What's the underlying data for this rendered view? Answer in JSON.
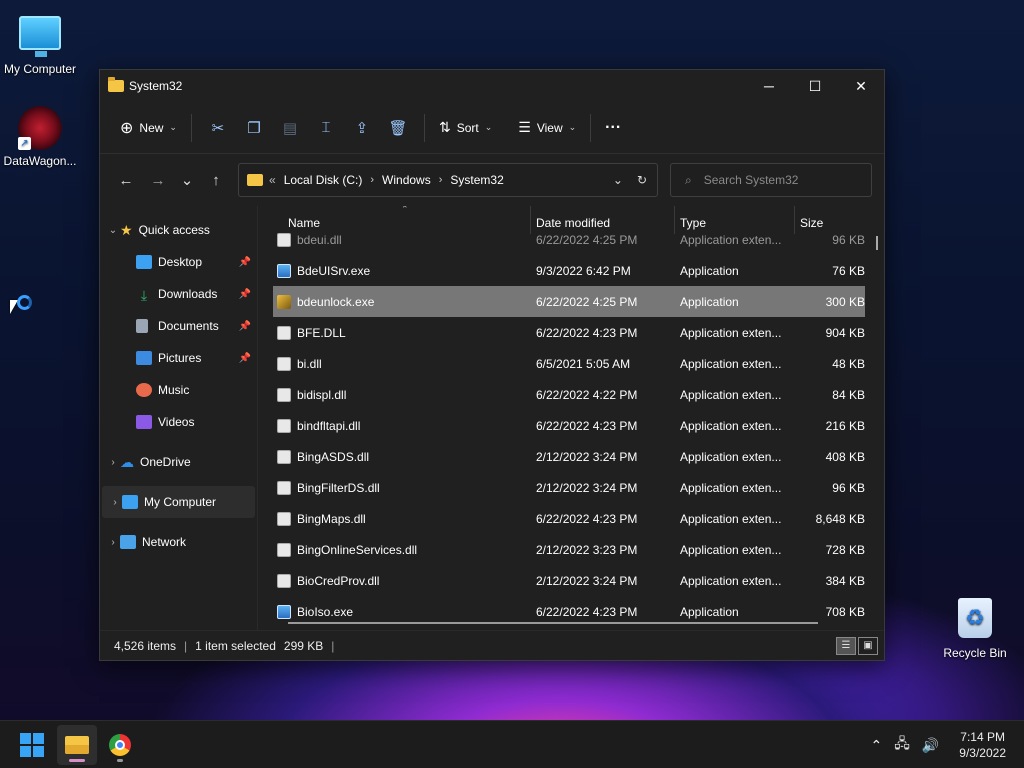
{
  "desktop": {
    "icons": [
      {
        "label": "My Computer"
      },
      {
        "label": "DataWagon..."
      },
      {
        "label": "Recycle Bin"
      }
    ]
  },
  "window": {
    "title": "System32",
    "controls": {
      "minimize": "─",
      "maximize": "☐",
      "close": "✕"
    }
  },
  "toolbar": {
    "new_label": "New",
    "sort_label": "Sort",
    "view_label": "View",
    "more_label": "···",
    "icons": [
      "cut-icon",
      "copy-icon",
      "paste-icon",
      "rename-icon",
      "share-icon",
      "delete-icon"
    ]
  },
  "navigation": {
    "back": "←",
    "forward": "→",
    "recent": "⌄",
    "up": "↑",
    "breadcrumb_prefix": "«",
    "breadcrumb": [
      "Local Disk (C:)",
      "Windows",
      "System32"
    ],
    "search_placeholder": "Search System32"
  },
  "sidebar": {
    "quick_access": "Quick access",
    "pinned": [
      {
        "label": "Desktop",
        "color": "#3ba1f0"
      },
      {
        "label": "Downloads",
        "color": "#2fb36b"
      },
      {
        "label": "Documents",
        "color": "#9aa5b5"
      },
      {
        "label": "Pictures",
        "color": "#3c8be0"
      },
      {
        "label": "Music",
        "color": "#e86a4a"
      },
      {
        "label": "Videos",
        "color": "#8a5ae6"
      }
    ],
    "onedrive": "OneDrive",
    "my_computer": "My Computer",
    "network": "Network"
  },
  "columns": {
    "name": "Name",
    "date": "Date modified",
    "type": "Type",
    "size": "Size"
  },
  "files": {
    "partial": {
      "name": "bdeui.dll",
      "date": "6/22/2022 4:25 PM",
      "type": "Application exten...",
      "size": "96 KB"
    },
    "rows": [
      {
        "name": "BdeUISrv.exe",
        "date": "9/3/2022 6:42 PM",
        "type": "Application",
        "size": "76 KB",
        "icon": "exe"
      },
      {
        "name": "bdeunlock.exe",
        "date": "6/22/2022 4:25 PM",
        "type": "Application",
        "size": "300 KB",
        "icon": "unlock"
      },
      {
        "name": "BFE.DLL",
        "date": "6/22/2022 4:23 PM",
        "type": "Application exten...",
        "size": "904 KB",
        "icon": "dll"
      },
      {
        "name": "bi.dll",
        "date": "6/5/2021 5:05 AM",
        "type": "Application exten...",
        "size": "48 KB",
        "icon": "dll"
      },
      {
        "name": "bidispl.dll",
        "date": "6/22/2022 4:22 PM",
        "type": "Application exten...",
        "size": "84 KB",
        "icon": "dll"
      },
      {
        "name": "bindfltapi.dll",
        "date": "6/22/2022 4:23 PM",
        "type": "Application exten...",
        "size": "216 KB",
        "icon": "dll"
      },
      {
        "name": "BingASDS.dll",
        "date": "2/12/2022 3:24 PM",
        "type": "Application exten...",
        "size": "408 KB",
        "icon": "dll"
      },
      {
        "name": "BingFilterDS.dll",
        "date": "2/12/2022 3:24 PM",
        "type": "Application exten...",
        "size": "96 KB",
        "icon": "dll"
      },
      {
        "name": "BingMaps.dll",
        "date": "6/22/2022 4:23 PM",
        "type": "Application exten...",
        "size": "8,648 KB",
        "icon": "dll"
      },
      {
        "name": "BingOnlineServices.dll",
        "date": "2/12/2022 3:23 PM",
        "type": "Application exten...",
        "size": "728 KB",
        "icon": "dll"
      },
      {
        "name": "BioCredProv.dll",
        "date": "2/12/2022 3:24 PM",
        "type": "Application exten...",
        "size": "384 KB",
        "icon": "dll"
      },
      {
        "name": "BioIso.exe",
        "date": "6/22/2022 4:23 PM",
        "type": "Application",
        "size": "708 KB",
        "icon": "exe"
      }
    ]
  },
  "status": {
    "items": "4,526 items",
    "selected": "1 item selected",
    "size": "299 KB",
    "separator": "|"
  },
  "taskbar": {
    "time": "7:14 PM",
    "date": "9/3/2022",
    "indicator_color": "#d590c8"
  }
}
